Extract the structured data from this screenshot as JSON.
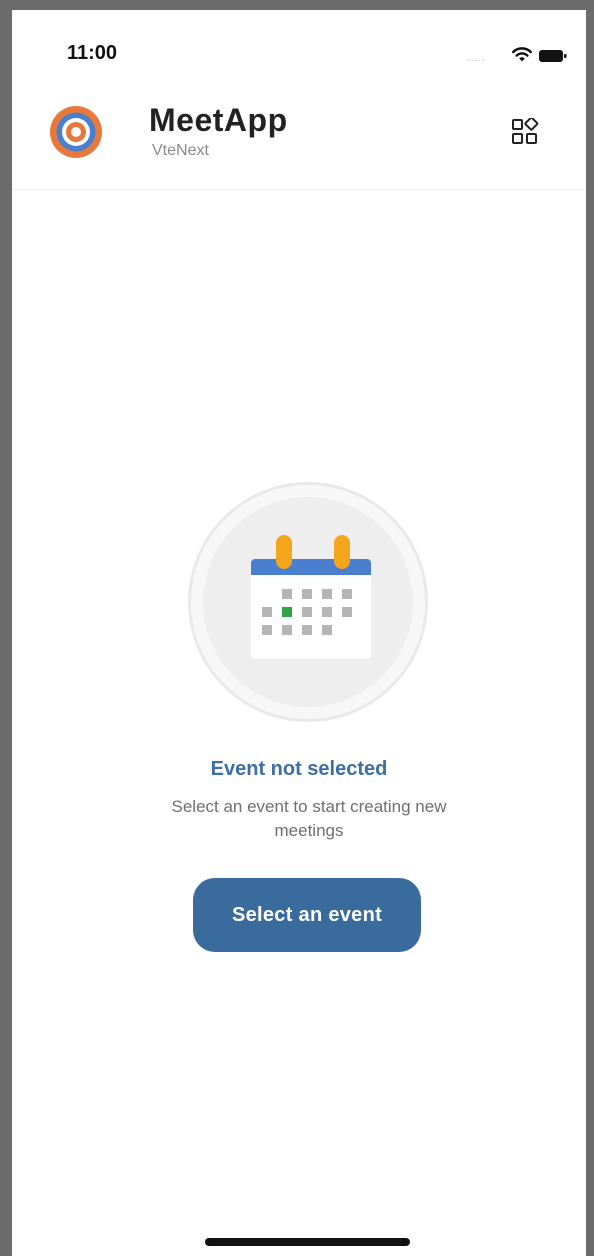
{
  "status_bar": {
    "time": "11:00",
    "signal_dots": ".....",
    "wifi_icon": "wifi-icon",
    "battery_icon": "battery-icon"
  },
  "header": {
    "app_name": "MeetApp",
    "subtitle": "VteNext",
    "logo_icon": "target-logo-icon",
    "menu_icon": "grid-apps-icon"
  },
  "empty_state": {
    "illustration_icon": "calendar-icon",
    "title": "Event not selected",
    "description": "Select an event to start creating new meetings",
    "button_label": "Select an event"
  },
  "colors": {
    "accent": "#3a6b9d",
    "title_text": "#3d6fa3",
    "logo_outer": "#e8793b",
    "logo_inner": "#4a7fcf",
    "calendar_header": "#4a7fcf",
    "calendar_rings": "#f3a51c",
    "calendar_highlight": "#2fa34a"
  }
}
